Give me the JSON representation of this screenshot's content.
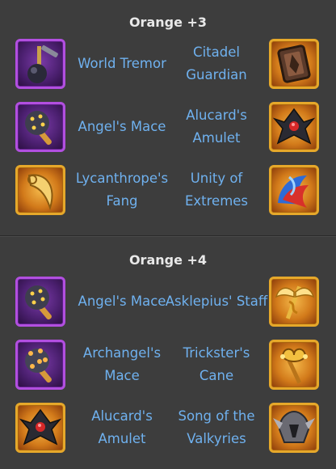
{
  "sections": [
    {
      "title": "Orange +3",
      "rows": [
        {
          "left": {
            "name": "World Tremor",
            "icon": "mace-flail-icon",
            "frame": "purple"
          },
          "right": {
            "name": "Citadel Guardian",
            "icon": "shield-armor-icon",
            "frame": "gold"
          }
        },
        {
          "left": {
            "name": "Angel's Mace",
            "icon": "spiked-mace-icon",
            "frame": "purple"
          },
          "right": {
            "name": "Alucard's Amulet",
            "icon": "amulet-icon",
            "frame": "gold"
          }
        },
        {
          "left": {
            "name": "Lycanthrope's Fang",
            "icon": "fang-horn-icon",
            "frame": "gold"
          },
          "right": {
            "name": "Unity of Extremes",
            "icon": "fire-ice-orb-icon",
            "frame": "gold"
          }
        }
      ]
    },
    {
      "title": "Orange +4",
      "rows": [
        {
          "left": {
            "name": "Angel's Mace",
            "icon": "spiked-mace-icon",
            "frame": "purple"
          },
          "right": {
            "name": "Asklepius' Staff",
            "icon": "winged-staff-icon",
            "frame": "gold"
          }
        },
        {
          "left": {
            "name": "Archangel's Mace",
            "icon": "spiked-mace-icon",
            "frame": "purple"
          },
          "right": {
            "name": "Trickster's Cane",
            "icon": "jester-cane-icon",
            "frame": "gold"
          }
        },
        {
          "left": {
            "name": "Alucard's Amulet",
            "icon": "amulet-icon",
            "frame": "gold"
          },
          "right": {
            "name": "Song of the Valkyries",
            "icon": "valkyrie-helm-icon",
            "frame": "gold"
          }
        }
      ]
    }
  ],
  "colors": {
    "name_text": "#6fb1ef",
    "title_text": "#e9e9e9",
    "background": "#3d3d3d",
    "purple_frame": "#b24fe0",
    "gold_frame": "#e6a82a"
  }
}
